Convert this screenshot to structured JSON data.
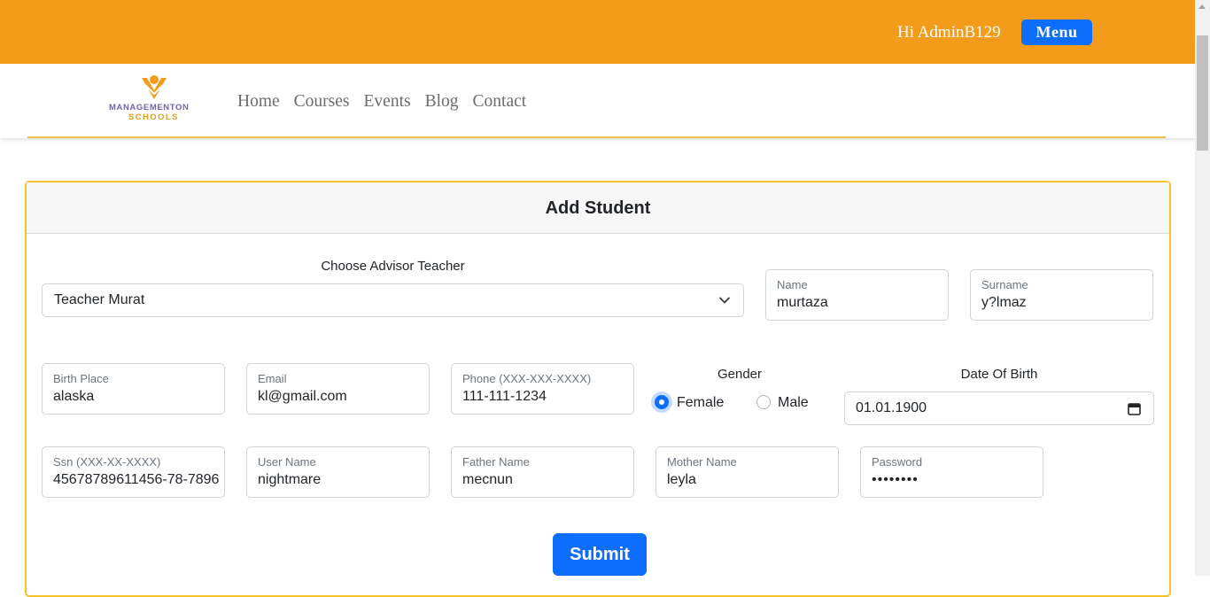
{
  "header": {
    "greeting": "Hi AdminB129",
    "menu_label": "Menu",
    "brand_color": "#f39c1b",
    "button_color": "#0d6efd"
  },
  "logo": {
    "line1": "MANAGEMENTON",
    "line2": "SCHOOLS"
  },
  "nav": {
    "items": [
      "Home",
      "Courses",
      "Events",
      "Blog",
      "Contact"
    ]
  },
  "form": {
    "title": "Add Student",
    "advisor_label": "Choose Advisor Teacher",
    "advisor_value": "Teacher Murat",
    "name": {
      "label": "Name",
      "value": "murtaza"
    },
    "surname": {
      "label": "Surname",
      "value": "y?lmaz"
    },
    "birth_place": {
      "label": "Birth Place",
      "value": "alaska"
    },
    "email": {
      "label": "Email",
      "value": "kl@gmail.com"
    },
    "phone": {
      "label": "Phone (XXX-XXX-XXXX)",
      "value": "111-111-1234"
    },
    "gender": {
      "label": "Gender",
      "options": [
        "Female",
        "Male"
      ],
      "selected": "Female"
    },
    "dob": {
      "label": "Date Of Birth",
      "value": "01.01.1900"
    },
    "ssn": {
      "label": "Ssn (XXX-XX-XXXX)",
      "value": "45678789611456-78-7896"
    },
    "username": {
      "label": "User Name",
      "value": "nightmare"
    },
    "father": {
      "label": "Father Name",
      "value": "mecnun"
    },
    "mother": {
      "label": "Mother Name",
      "value": "leyla"
    },
    "password": {
      "label": "Password",
      "value": "••••••••"
    },
    "submit_label": "Submit"
  }
}
